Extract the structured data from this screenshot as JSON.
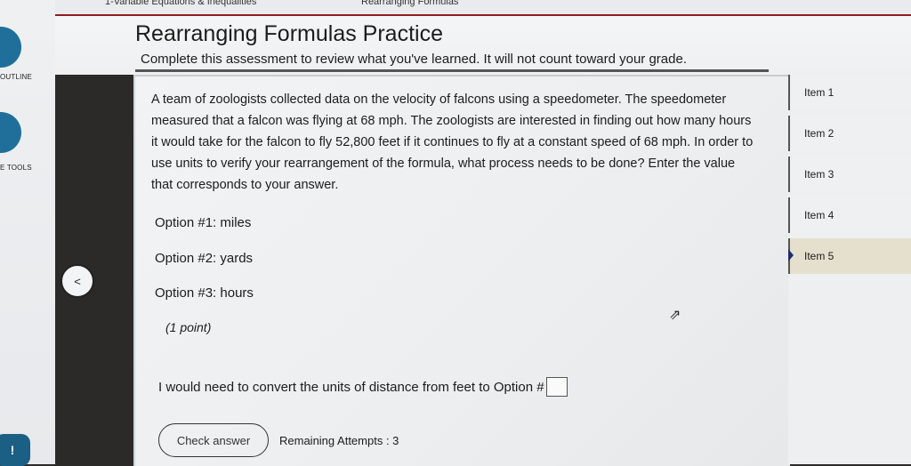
{
  "breadcrumb": {
    "left": "1-Variable Equations & Inequalities",
    "right": "Rearranging Formulas"
  },
  "sidebar": {
    "outline_label": "OUTLINE",
    "tools_label": "E TOOLS",
    "badge": "!"
  },
  "header": {
    "title": "Rearranging Formulas Practice",
    "subtitle": "Complete this assessment to review what you've learned. It will not count toward your grade."
  },
  "question": {
    "text": "A team of zoologists collected data on the velocity of falcons using a speedometer. The speedometer measured that a falcon was flying at 68 mph. The zoologists are interested in finding out how many hours it would take for the falcon to fly 52,800 feet if it continues to fly at a constant speed of 68 mph. In order to use units to verify your rearrangement of the formula, what process needs to be done? Enter the value that corresponds to your answer.",
    "options": [
      "Option #1: miles",
      "Option #2: yards",
      "Option #3: hours"
    ],
    "points": "(1 point)",
    "answer_prompt": "I would need to convert the units of distance from feet to Option #",
    "answer_value": ""
  },
  "actions": {
    "check_answer": "Check answer",
    "remaining_attempts": "Remaining Attempts : 3"
  },
  "navigation": {
    "prev_symbol": "<"
  },
  "items": [
    {
      "label": "Item 1"
    },
    {
      "label": "Item 2"
    },
    {
      "label": "Item 3"
    },
    {
      "label": "Item 4"
    },
    {
      "label": "Item 5",
      "active": true
    }
  ],
  "colors": {
    "accent": "#1f6f9a",
    "header_rule": "#8f1e1e",
    "active_item": "#e5e0ce"
  }
}
